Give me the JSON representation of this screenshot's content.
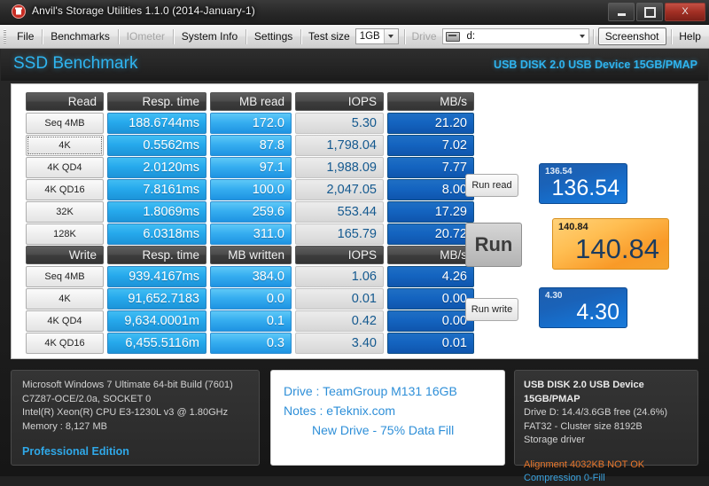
{
  "window": {
    "title": "Anvil's Storage Utilities 1.1.0 (2014-January-1)",
    "app_icon": "anvil-icon",
    "minimize": "–",
    "maximize": "□",
    "close": "X"
  },
  "menu": {
    "items": [
      {
        "label": "File",
        "enabled": true
      },
      {
        "label": "Benchmarks",
        "enabled": true
      },
      {
        "label": "IOmeter",
        "enabled": false
      },
      {
        "label": "System Info",
        "enabled": true
      },
      {
        "label": "Settings",
        "enabled": true
      }
    ],
    "test_size_label": "Test size",
    "test_size_value": "1GB",
    "drive_label": "Drive",
    "drive_value": "d:",
    "screenshot_label": "Screenshot",
    "help_label": "Help"
  },
  "banner": {
    "title": "SSD Benchmark",
    "device": "USB DISK 2.0 USB Device 15GB/PMAP"
  },
  "read_table": {
    "headers": [
      "Read",
      "Resp. time",
      "MB read",
      "IOPS",
      "MB/s"
    ],
    "rows": [
      {
        "label": "Seq 4MB",
        "resp": "188.6744ms",
        "mb": "172.0",
        "iops": "5.30",
        "mbs": "21.20",
        "focused": false
      },
      {
        "label": "4K",
        "resp": "0.5562ms",
        "mb": "87.8",
        "iops": "1,798.04",
        "mbs": "7.02",
        "focused": true
      },
      {
        "label": "4K QD4",
        "resp": "2.0120ms",
        "mb": "97.1",
        "iops": "1,988.09",
        "mbs": "7.77",
        "focused": false
      },
      {
        "label": "4K QD16",
        "resp": "7.8161ms",
        "mb": "100.0",
        "iops": "2,047.05",
        "mbs": "8.00",
        "focused": false
      },
      {
        "label": "32K",
        "resp": "1.8069ms",
        "mb": "259.6",
        "iops": "553.44",
        "mbs": "17.29",
        "focused": false
      },
      {
        "label": "128K",
        "resp": "6.0318ms",
        "mb": "311.0",
        "iops": "165.79",
        "mbs": "20.72",
        "focused": false
      }
    ]
  },
  "write_table": {
    "headers": [
      "Write",
      "Resp. time",
      "MB written",
      "IOPS",
      "MB/s"
    ],
    "rows": [
      {
        "label": "Seq 4MB",
        "resp": "939.4167ms",
        "mb": "384.0",
        "iops": "1.06",
        "mbs": "4.26",
        "focused": false
      },
      {
        "label": "4K",
        "resp": "91,652.7183",
        "mb": "0.0",
        "iops": "0.01",
        "mbs": "0.00",
        "focused": false
      },
      {
        "label": "4K QD4",
        "resp": "9,634.0001m",
        "mb": "0.1",
        "iops": "0.42",
        "mbs": "0.00",
        "focused": false
      },
      {
        "label": "4K QD16",
        "resp": "6,455.5116m",
        "mb": "0.3",
        "iops": "3.40",
        "mbs": "0.01",
        "focused": false
      }
    ]
  },
  "controls": {
    "run_read": "Run read",
    "run": "Run",
    "run_write": "Run write"
  },
  "scores": {
    "read": {
      "small": "136.54",
      "big": "136.54"
    },
    "total": {
      "small": "140.84",
      "big": "140.84"
    },
    "write": {
      "small": "4.30",
      "big": "4.30"
    }
  },
  "system_info": {
    "os": "Microsoft Windows 7 Ultimate  64-bit Build (7601)",
    "board": "C7Z87-OCE/2.0a, SOCKET 0",
    "cpu": "Intel(R) Xeon(R) CPU E3-1230L v3 @ 1.80GHz",
    "memory": "Memory : 8,127 MB",
    "edition": "Professional Edition"
  },
  "notes": {
    "drive": "Drive : TeamGroup M131 16GB",
    "notes": "Notes : eTeknix.com",
    "extra": "New Drive - 75% Data Fill"
  },
  "drive_info": {
    "device": "USB DISK 2.0 USB Device 15GB/PMAP",
    "capacity": "Drive D: 14.4/3.6GB free (24.6%)",
    "filesystem": "FAT32 - Cluster size 8192B",
    "driver": "Storage driver",
    "alignment": "Alignment 4032KB NOT OK",
    "compression": "Compression 0-Fill"
  },
  "colors": {
    "accent_cyan": "#2fb4ef",
    "score_blue": "#1a62b8",
    "score_orange": "#f99a28",
    "warn_orange": "#e8762a"
  }
}
